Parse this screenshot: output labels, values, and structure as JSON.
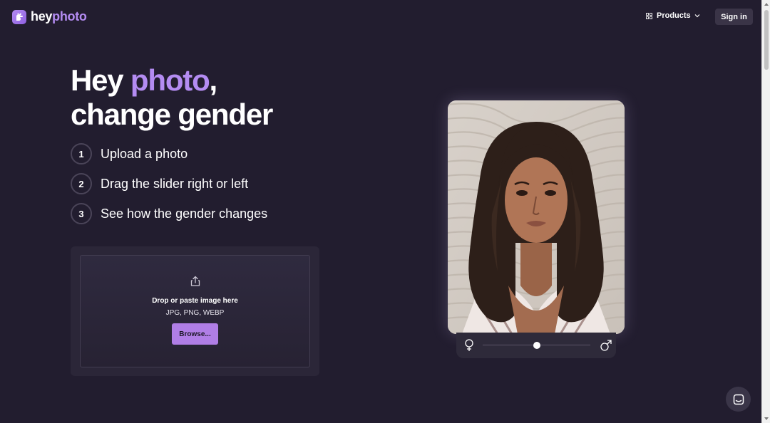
{
  "brand": {
    "name_part1": "hey",
    "name_part2": "photo"
  },
  "nav": {
    "products_label": "Products",
    "signin_label": "Sign in"
  },
  "hero": {
    "title_part1": "Hey ",
    "title_accent": "photo",
    "title_part2": ",",
    "title_line2": "change gender"
  },
  "steps": [
    {
      "number": "1",
      "text": "Upload a photo"
    },
    {
      "number": "2",
      "text": "Drag the slider right or left"
    },
    {
      "number": "3",
      "text": "See how the gender changes"
    }
  ],
  "upload": {
    "title": "Drop or paste image here",
    "formats": "JPG, PNG, WEBP",
    "browse_label": "Browse..."
  },
  "gender_slider": {
    "value": 0.5
  },
  "colors": {
    "background": "#221d2f",
    "accent": "#b48cf2",
    "button": "#b07ee6"
  },
  "icons": {
    "upload": "upload-icon",
    "female": "female-symbol-icon",
    "male": "male-symbol-icon",
    "chat": "chat-icon",
    "grid": "grid-icon"
  }
}
